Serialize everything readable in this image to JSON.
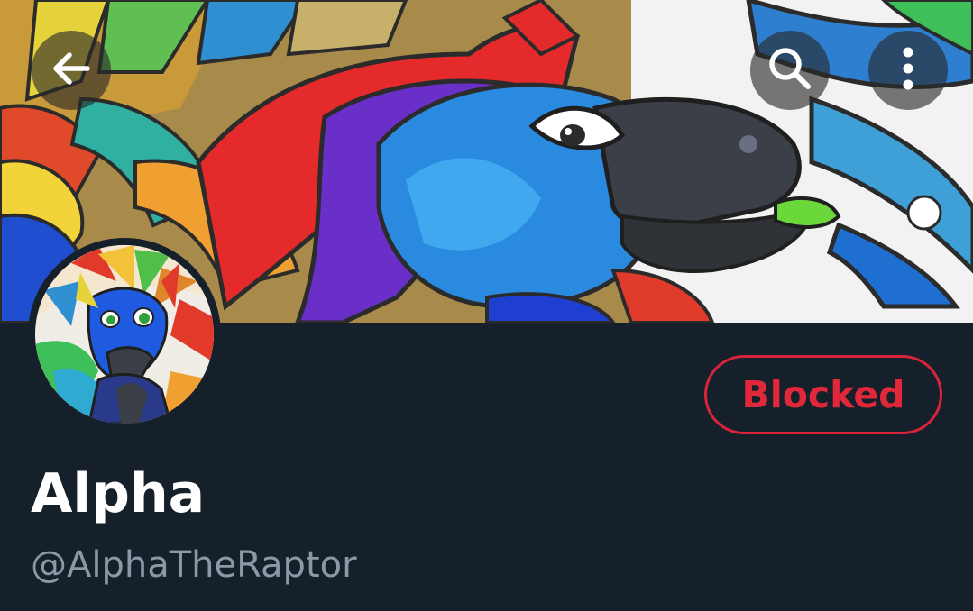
{
  "header": {
    "back_icon": "arrow-left-icon",
    "search_icon": "search-icon",
    "more_icon": "more-vertical-icon"
  },
  "profile": {
    "name": "Alpha",
    "handle": "@AlphaTheRaptor",
    "block_status_label": "Blocked"
  },
  "colors": {
    "background": "#15202b",
    "blocked_accent": "#e0283a",
    "handle_text": "#8b98a5",
    "name_text": "#ffffff"
  }
}
